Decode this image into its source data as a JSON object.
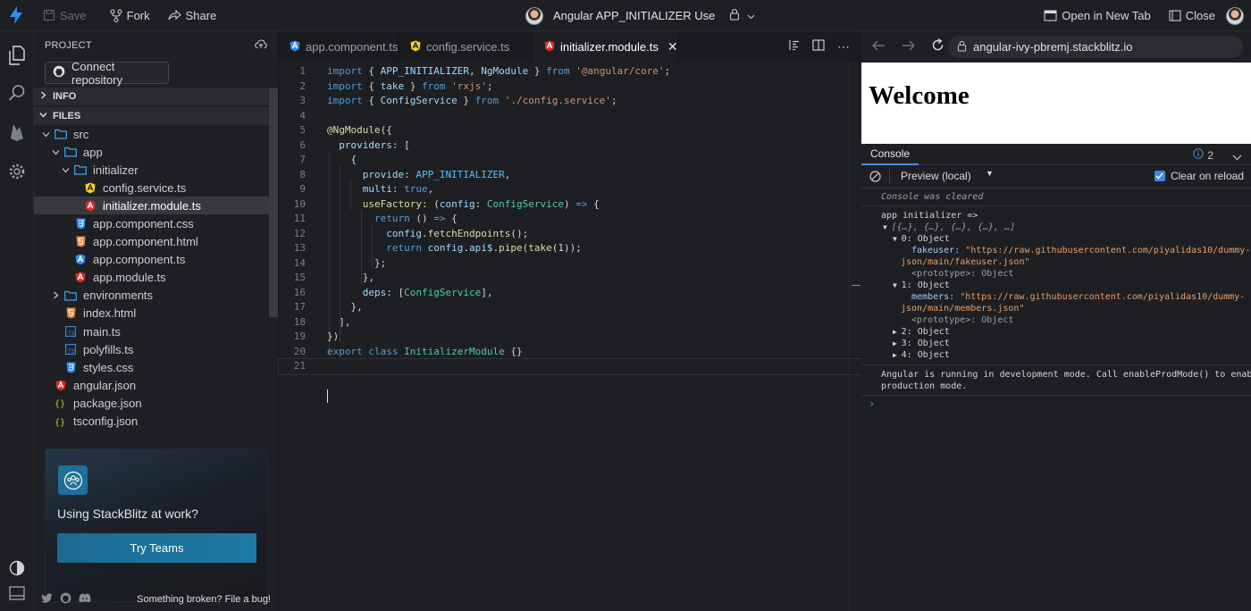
{
  "topbar": {
    "save_label": "Save",
    "fork_label": "Fork",
    "share_label": "Share",
    "project_title": "Angular APP_INITIALIZER Use",
    "open_new_tab_label": "Open in New Tab",
    "close_label": "Close"
  },
  "sidebar": {
    "header": "PROJECT",
    "connect_label": "Connect repository",
    "info_label": "INFO",
    "files_label": "FILES",
    "tree": [
      {
        "name": "src",
        "type": "folder"
      },
      {
        "name": "app",
        "type": "folder"
      },
      {
        "name": "initializer",
        "type": "folder"
      },
      {
        "name": "config.service.ts",
        "type": "angular-ts"
      },
      {
        "name": "initializer.module.ts",
        "type": "angular-module",
        "selected": true
      },
      {
        "name": "app.component.css",
        "type": "css"
      },
      {
        "name": "app.component.html",
        "type": "html"
      },
      {
        "name": "app.component.ts",
        "type": "angular-component"
      },
      {
        "name": "app.module.ts",
        "type": "angular-module"
      },
      {
        "name": "environments",
        "type": "folder"
      },
      {
        "name": "index.html",
        "type": "html"
      },
      {
        "name": "main.ts",
        "type": "ts"
      },
      {
        "name": "polyfills.ts",
        "type": "ts"
      },
      {
        "name": "styles.css",
        "type": "css"
      },
      {
        "name": "angular.json",
        "type": "angular-json"
      },
      {
        "name": "package.json",
        "type": "json"
      },
      {
        "name": "tsconfig.json",
        "type": "json"
      }
    ],
    "teams_text": "Using StackBlitz at work?",
    "teams_button": "Try Teams",
    "bug_text": "Something broken? File a bug!"
  },
  "editor": {
    "tabs": [
      {
        "label": "app.component.ts",
        "active": false
      },
      {
        "label": "config.service.ts",
        "active": false
      },
      {
        "label": "initializer.module.ts",
        "active": true
      }
    ],
    "line_numbers": [
      "1",
      "2",
      "3",
      "4",
      "5",
      "6",
      "7",
      "8",
      "9",
      "10",
      "11",
      "12",
      "13",
      "14",
      "15",
      "16",
      "17",
      "18",
      "19",
      "20",
      "21"
    ]
  },
  "preview": {
    "url": "angular-ivy-pbremj.stackblitz.io",
    "heading": "Welcome",
    "console_tab": "Console",
    "issues_count": "2",
    "context_select": "Preview (local)",
    "clear_on_reload": "Clear on reload",
    "cleared_msg": "Console was cleared",
    "log_label": "app initializer =>",
    "array_summary": "[{…}, {…}, {…}, {…}, …]",
    "items": [
      {
        "index": "0: Object",
        "key": "fakeuser:",
        "value_line1": "\"https://raw.githubusercontent.com/piyalidas10/dummy-",
        "value_line2": "json/main/fakeuser.json\"",
        "proto": "<prototype>: Object"
      },
      {
        "index": "1: Object",
        "key": "members:",
        "value_line1": "\"https://raw.githubusercontent.com/piyalidas10/dummy-",
        "value_line2": "json/main/members.json\"",
        "proto": "<prototype>: Object"
      },
      {
        "index": "2: Object"
      },
      {
        "index": "3: Object"
      },
      {
        "index": "4: Object"
      }
    ],
    "dev_msg_line1": "Angular is running in development mode. Call enableProdMode() to enable",
    "dev_msg_line2": "production mode."
  },
  "colors": {
    "accent": "#3b8ae8",
    "angular_red": "#dd2c2c",
    "angular_yellow": "#f5d328",
    "teams_button": "#1e7aa4"
  }
}
